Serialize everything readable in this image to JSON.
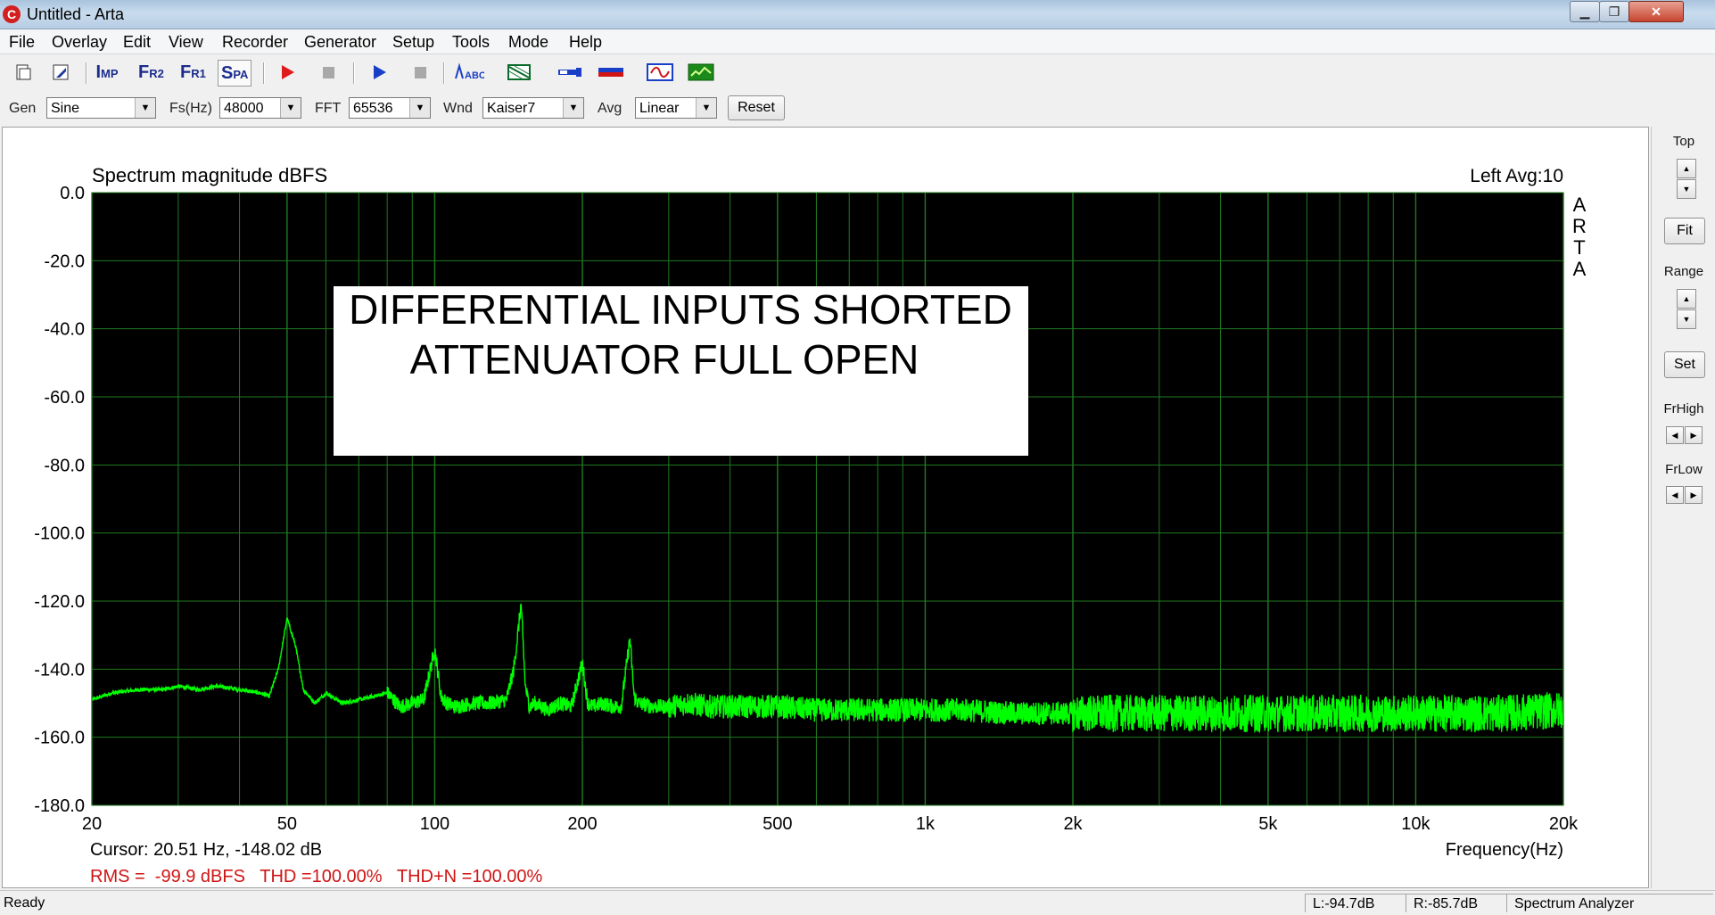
{
  "window": {
    "title": "Untitled - Arta",
    "app_icon": "C",
    "min": "▁",
    "max": "❐",
    "close": "✕"
  },
  "menu": [
    "File",
    "Overlay",
    "Edit",
    "View",
    "Recorder",
    "Generator",
    "Setup",
    "Tools",
    "Mode",
    "Help"
  ],
  "toolbar": {
    "imp": "I",
    "imp_small": "MP",
    "fr2": "F",
    "fr2_small": "R2",
    "fr1": "F",
    "fr1_small": "R1",
    "spa": "S",
    "spa_small": "PA",
    "icons": [
      "new-file-icon",
      "open-file-icon",
      "record-play-icon",
      "record-stop-icon",
      "generator-play-icon",
      "generator-stop-icon",
      "abc-label-icon",
      "overlay-grid-icon",
      "probe-icon",
      "calibration-icon",
      "scope-icon",
      "spectrum-view-icon"
    ]
  },
  "controls": {
    "gen_label": "Gen",
    "gen_value": "Sine",
    "fs_label": "Fs(Hz)",
    "fs_value": "48000",
    "fft_label": "FFT",
    "fft_value": "65536",
    "wnd_label": "Wnd",
    "wnd_value": "Kaiser7",
    "avg_label": "Avg",
    "avg_value": "Linear",
    "reset_label": "Reset"
  },
  "graph": {
    "channel_info": "Left  Avg:10",
    "watermark": [
      "A",
      "R",
      "T",
      "A"
    ],
    "annotation_line1": "DIFFERENTIAL INPUTS SHORTED",
    "annotation_line2": "ATTENUATOR FULL OPEN",
    "cursor_readout": "Cursor: 20.51 Hz, -148.02 dB",
    "measurements": "RMS =  -99.9 dBFS   THD =100.00%   THD+N =100.00%",
    "trace_color": "#00ff00",
    "grid_color": "#1f7a1f",
    "plot_bg": "#000000",
    "text_red": "#d01414"
  },
  "chart_data": {
    "type": "line",
    "title": "Spectrum magnitude dBFS",
    "xlabel": "Frequency(Hz)",
    "ylabel": "",
    "x_scale": "log",
    "xlim": [
      20,
      20000
    ],
    "ylim": [
      -180,
      0
    ],
    "x_ticks": [
      20,
      50,
      100,
      200,
      500,
      1000,
      2000,
      5000,
      10000,
      20000
    ],
    "x_tick_labels": [
      "20",
      "50",
      "100",
      "200",
      "500",
      "1k",
      "2k",
      "5k",
      "10k",
      "20k"
    ],
    "y_ticks": [
      0,
      -20,
      -40,
      -60,
      -80,
      -100,
      -120,
      -140,
      -160,
      -180
    ],
    "y_tick_labels": [
      "0.0",
      "-20.0",
      "-40.0",
      "-60.0",
      "-80.0",
      "-100.0",
      "-120.0",
      "-140.0",
      "-160.0",
      "-180.0"
    ],
    "grid": true,
    "series": [
      {
        "color": "#00ff00",
        "x": [
          20,
          22,
          25,
          28,
          30,
          33,
          36,
          40,
          44,
          46,
          48,
          50,
          52,
          54,
          57,
          60,
          65,
          70,
          75,
          80,
          85,
          90,
          95,
          100,
          103,
          106,
          110,
          120,
          130,
          140,
          145,
          150,
          153,
          156,
          160,
          170,
          180,
          190,
          200,
          205,
          210,
          220,
          230,
          240,
          250,
          255,
          260,
          280,
          300,
          330,
          360,
          400,
          450,
          500,
          600,
          700,
          800,
          1000,
          1200,
          1500,
          2000,
          3000,
          4000,
          5000,
          6000,
          8000,
          10000,
          15000,
          20000
        ],
        "values": [
          -149,
          -147,
          -146,
          -146,
          -145,
          -146,
          -145,
          -146,
          -147,
          -148,
          -140,
          -125,
          -133,
          -146,
          -150,
          -147,
          -150,
          -149,
          -148,
          -147,
          -151,
          -150,
          -149,
          -134,
          -148,
          -150,
          -151,
          -150,
          -150,
          -149,
          -140,
          -121,
          -145,
          -151,
          -150,
          -152,
          -150,
          -151,
          -138,
          -150,
          -151,
          -150,
          -151,
          -151,
          -131,
          -148,
          -150,
          -151,
          -151,
          -150,
          -151,
          -151,
          -151,
          -151,
          -152,
          -152,
          -152,
          -152,
          -152,
          -153,
          -153,
          -153,
          -153,
          -153,
          -153,
          -153,
          -153,
          -153,
          -152
        ]
      }
    ]
  },
  "right_panel": {
    "top_label": "Top",
    "fit_label": "Fit",
    "range_label": "Range",
    "set_label": "Set",
    "frhigh_label": "FrHigh",
    "frlow_label": "FrLow",
    "up": "▲",
    "down": "▼",
    "left": "◀",
    "right": "▶"
  },
  "status": {
    "ready": "Ready",
    "left_level": "L:-94.7dB",
    "right_level": "R:-85.7dB",
    "mode": "Spectrum Analyzer"
  }
}
